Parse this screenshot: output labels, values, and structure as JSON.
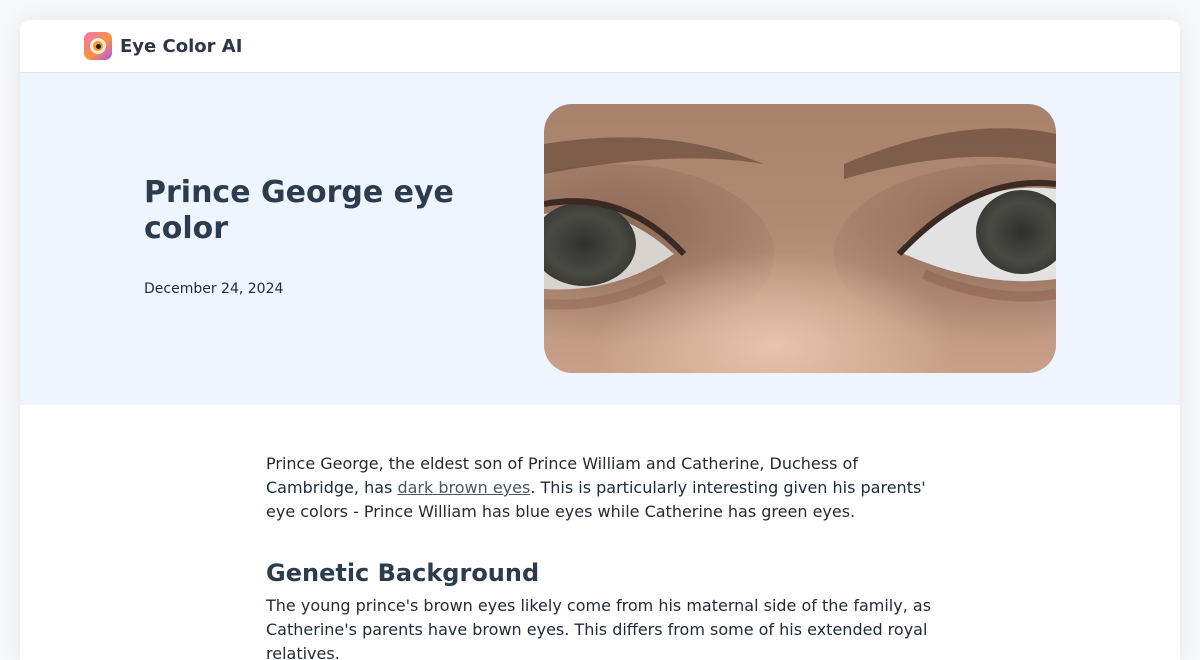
{
  "header": {
    "brand": "Eye Color AI",
    "logo_icon": "eye-logo-icon"
  },
  "hero": {
    "title": "Prince George eye color",
    "date": "December 24, 2024",
    "image_alt": "close-up of eyes",
    "image_icon": "eyes-closeup-photo"
  },
  "article": {
    "intro_before": "Prince George, the eldest son of Prince William and Catherine, Duchess of Cambridge, has ",
    "intro_link": "dark brown eyes",
    "intro_after": ". This is particularly interesting given his parents' eye colors - Prince William has blue eyes while Catherine has green eyes.",
    "section_heading": "Genetic Background",
    "section_body": "The young prince's brown eyes likely come from his maternal side of the family, as Catherine's parents have brown eyes. This differs from some of his extended royal relatives."
  },
  "colors": {
    "hero_background": "#eef5ff",
    "heading": "#2d3b4e",
    "link": "#4b5563",
    "page_background": "#f7f8fa"
  }
}
